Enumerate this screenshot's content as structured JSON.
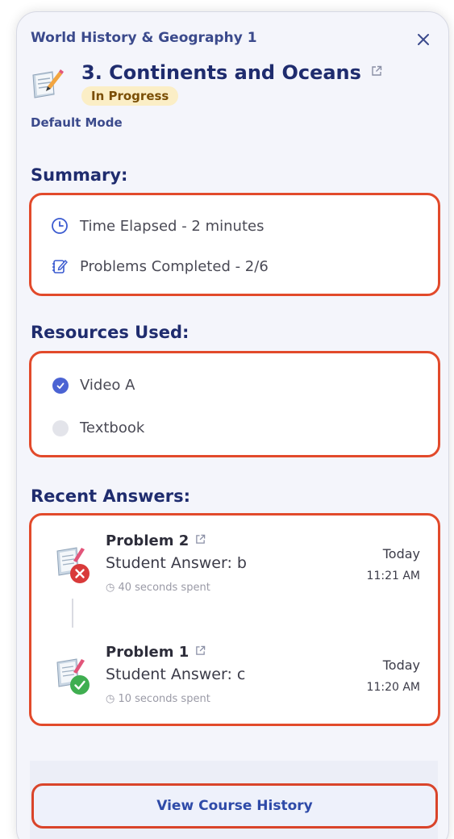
{
  "header": {
    "course_name": "World History & Geography 1",
    "lesson_title": "3. Continents and Oceans",
    "status": "In Progress",
    "mode": "Default Mode"
  },
  "summary": {
    "title": "Summary:",
    "time_elapsed": "Time Elapsed - 2 minutes",
    "problems_completed": "Problems Completed - 2/6"
  },
  "resources": {
    "title": "Resources Used:",
    "items": [
      {
        "label": "Video A",
        "checked": true
      },
      {
        "label": "Textbook",
        "checked": false
      }
    ]
  },
  "recent_answers": {
    "title": "Recent Answers:",
    "items": [
      {
        "problem": "Problem 2",
        "answer": "Student Answer: b",
        "time_spent": "40 seconds spent",
        "day": "Today",
        "time": "11:21 AM",
        "result": "incorrect"
      },
      {
        "problem": "Problem 1",
        "answer": "Student Answer: c",
        "time_spent": "10 seconds spent",
        "day": "Today",
        "time": "11:20 AM",
        "result": "correct"
      }
    ]
  },
  "footer": {
    "history_button": "View Course History"
  },
  "colors": {
    "accent": "#1f2c6e",
    "highlight_border": "#e24a2b",
    "badge_bg": "#fbeec6",
    "check_on": "#4b63d3",
    "correct": "#3fae50",
    "incorrect": "#d93a3a"
  }
}
